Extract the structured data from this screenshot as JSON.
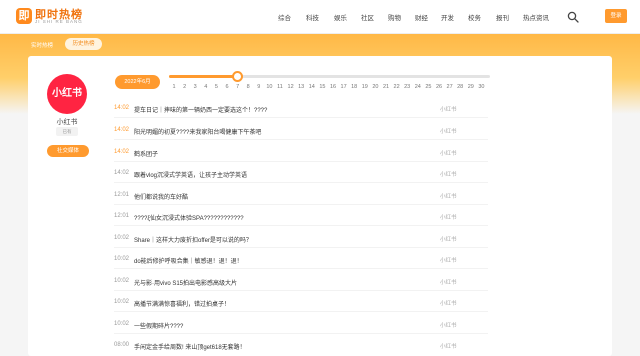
{
  "header": {
    "logo_mark": "即",
    "logo_title": "即时热榜",
    "logo_sub": "JI SHI RE BANG",
    "nav": [
      "综合",
      "科技",
      "娱乐",
      "社区",
      "购物",
      "财经",
      "开发",
      "校务",
      "报刊",
      "热点资讯"
    ],
    "login_label": "登录"
  },
  "breadcrumb": {
    "home": "实时热榜",
    "current": "历史热榜"
  },
  "profile": {
    "avatar_text": "小红书",
    "name": "小红书",
    "badge": "已有",
    "button": "社交媒体"
  },
  "timeline": {
    "month_label": "2022年6月",
    "days": [
      "1",
      "2",
      "3",
      "4",
      "5",
      "6",
      "7",
      "8",
      "9",
      "10",
      "11",
      "12",
      "13",
      "14",
      "15",
      "16",
      "17",
      "18",
      "19",
      "20",
      "21",
      "22",
      "23",
      "24",
      "25",
      "26",
      "27",
      "28",
      "29",
      "30"
    ],
    "selected_day": 7
  },
  "entries": [
    {
      "time": "14:02",
      "title": "提车日记｜摔味的第一辆奶西一定要选这个！????",
      "source": "小红书",
      "hot": true
    },
    {
      "time": "14:02",
      "title": "阳光明媚的初夏????来我家阳台喝健康下午茶吧",
      "source": "小红书",
      "hot": true
    },
    {
      "time": "14:02",
      "title": "鹤系团子",
      "source": "小红书",
      "hot": true
    },
    {
      "time": "14:02",
      "title": "跟着vlog沉浸式学英语，让孩子主动学英语",
      "source": "小红书",
      "hot": false
    },
    {
      "time": "12:01",
      "title": "他们都说我的车好酷",
      "source": "小红书",
      "hot": false
    },
    {
      "time": "12:01",
      "title": "????ξ仙女沉浸式体验SPA????????????",
      "source": "小红书",
      "hot": false
    },
    {
      "time": "10:02",
      "title": "Share｜这样大力废折扣offer是可以说的吗？",
      "source": "小红书",
      "hot": false
    },
    {
      "time": "10:02",
      "title": "do能后修护呼吸合集｜敏感退！退！退！",
      "source": "小红书",
      "hot": false
    },
    {
      "time": "10:02",
      "title": "光与影·用vivo S15拍出电影感高级大片",
      "source": "小红书",
      "hot": false
    },
    {
      "time": "10:02",
      "title": "高播节满满惊喜福利，错过拍桌子！",
      "source": "小红书",
      "hot": false
    },
    {
      "time": "10:02",
      "title": "一些假期碎片????",
      "source": "小红书",
      "hot": false
    },
    {
      "time": "08:00",
      "title": "手闲定金手给周数! 来山顶get618无套路！",
      "source": "小红书",
      "hot": false
    }
  ],
  "colors": {
    "accent": "#ff9a2e",
    "brand_red": "#ff2442"
  }
}
